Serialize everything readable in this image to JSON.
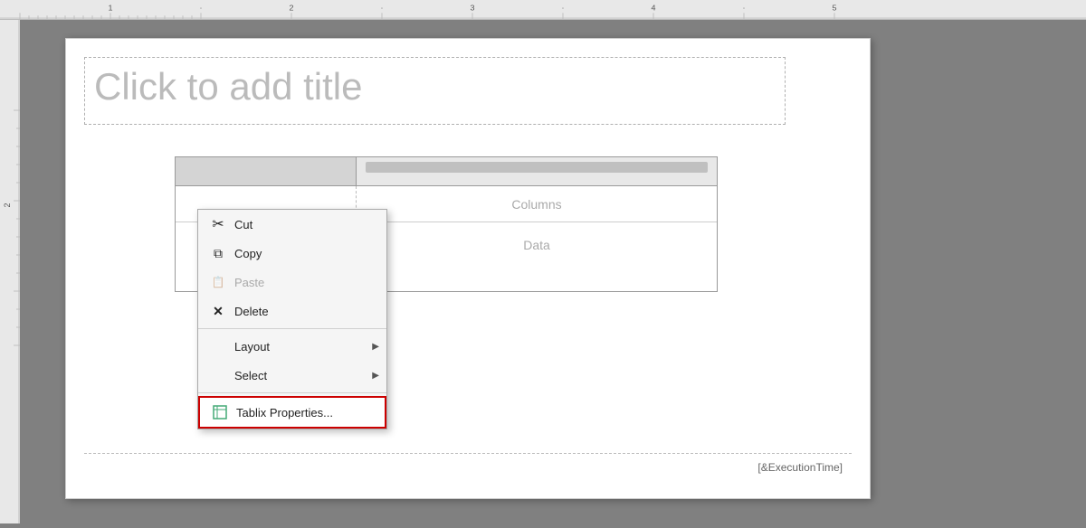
{
  "ruler": {
    "marks": [
      "1",
      "2",
      "3",
      "4",
      "5"
    ]
  },
  "title": {
    "placeholder": "Click to add title"
  },
  "tablix": {
    "columns_label": "Columns",
    "data_label": "Data"
  },
  "footer": {
    "execution_time": "[&ExecutionTime]"
  },
  "context_menu": {
    "items": [
      {
        "id": "cut",
        "label": "Cut",
        "icon": "✂",
        "enabled": true,
        "submenu": false
      },
      {
        "id": "copy",
        "label": "Copy",
        "icon": "⧉",
        "enabled": true,
        "submenu": false
      },
      {
        "id": "paste",
        "label": "Paste",
        "icon": "📋",
        "enabled": false,
        "submenu": false
      },
      {
        "id": "delete",
        "label": "Delete",
        "icon": "✕",
        "enabled": true,
        "submenu": false
      },
      {
        "id": "separator1",
        "type": "separator"
      },
      {
        "id": "layout",
        "label": "Layout",
        "icon": "",
        "enabled": true,
        "submenu": true
      },
      {
        "id": "select",
        "label": "Select",
        "icon": "",
        "enabled": true,
        "submenu": true
      },
      {
        "id": "separator2",
        "type": "separator"
      },
      {
        "id": "tablix-props",
        "label": "Tablix Properties...",
        "icon": "⊞",
        "enabled": true,
        "submenu": false,
        "highlighted": true
      }
    ]
  }
}
